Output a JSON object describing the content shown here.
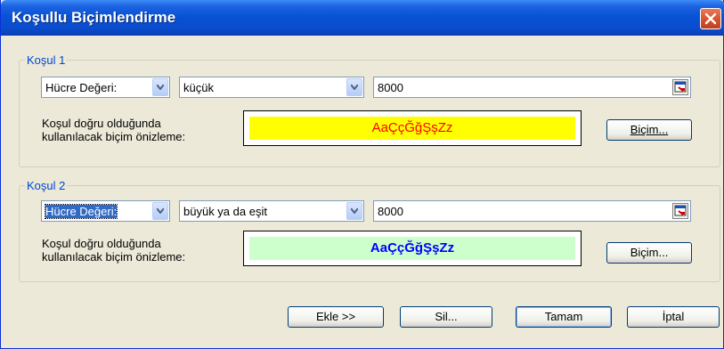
{
  "window": {
    "title": "Koşullu Biçimlendirme"
  },
  "condition1": {
    "group_label": "Koşul 1",
    "type_value": "Hücre Değeri:",
    "operator_value": "küçük",
    "value": "8000",
    "preview_label_line1": "Koşul doğru olduğunda",
    "preview_label_line2": "kullanılacak biçim önizleme:",
    "preview_text": "AaÇçĞğŞşZz",
    "preview_bg": "#ffff00",
    "preview_color": "#ff0000",
    "format_button": "Biçim..."
  },
  "condition2": {
    "group_label": "Koşul 2",
    "type_value": "Hücre Değeri:",
    "operator_value": "büyük ya da eşit",
    "value": "8000",
    "preview_label_line1": "Koşul doğru olduğunda",
    "preview_label_line2": "kullanılacak biçim önizleme:",
    "preview_text": "AaÇçĞğŞşZz",
    "preview_bg": "#ccffcc",
    "preview_color": "#0000ff",
    "format_button": "Biçim..."
  },
  "buttons": {
    "add": "Ekle >>",
    "delete": "Sil...",
    "ok": "Tamam",
    "cancel": "İptal"
  }
}
